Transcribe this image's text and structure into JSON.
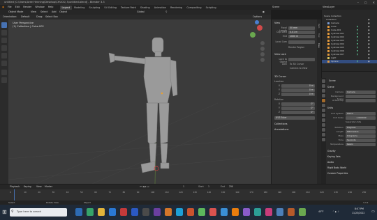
{
  "window": {
    "title": "untitled [C:\\Users\\Aree Henning\\Desktop\\CHUCK\\ 3\\untitled.blend] - Blender 3.3",
    "min": "–",
    "max": "▢",
    "close": "✕"
  },
  "menu": [
    "File",
    "Edit",
    "Render",
    "Window",
    "Help"
  ],
  "workspaces": [
    "Layout",
    "Modeling",
    "Sculpting",
    "UV Editing",
    "Texture Paint",
    "Shading",
    "Animation",
    "Rendering",
    "Compositing",
    "Scripting"
  ],
  "active_workspace": "Layout",
  "scene": "Scene",
  "view_layer": "ViewLayer",
  "viewport_header": {
    "mode": "Object Mode",
    "view": "View",
    "select": "Select",
    "add": "Add",
    "object": "Object",
    "transform": "Global",
    "orientation": "Orientation:",
    "orientation_value": "Default",
    "drag": "Drag:",
    "drag_value": "Select Box",
    "options": "Options"
  },
  "viewport": {
    "line1": "User Perspective",
    "line2": "(1) Collection | Cube.002"
  },
  "npanel": {
    "view_title": "View",
    "focal_label": "Focal Length",
    "focal_value": "50 mm",
    "clip_label": "Clip Start",
    "clip_start": "0.01 m",
    "end_label": "End",
    "clip_end": "1000 m",
    "local_label": "Local Cam",
    "render_region": "Render Region",
    "view_lock": "View Lock",
    "lock_obj_label": "Lock to Object",
    "lock_label": "Lock",
    "lock_3d": "To 3D Cursor",
    "lock_cam": "Camera to View",
    "cursor_title": "3D Cursor",
    "location_label": "Location",
    "x_label": "X",
    "y_label": "Y",
    "z_label": "Z",
    "cx": "0 m",
    "cy": "0 m",
    "cz": "0 m",
    "rotation_label": "Rotation",
    "rx": "0°",
    "ry": "0°",
    "rz": "0°",
    "rot_mode": "XYZ Euler",
    "collections": "Collections",
    "annotations": "Annotations"
  },
  "vtabs": [
    "Item",
    "Tool",
    "View"
  ],
  "outliner": {
    "header": "Scene Collection",
    "collection": "Collection",
    "items": [
      "Camera",
      "Cube",
      "Cube.001",
      "Cylinder.001",
      "Cylinder.002",
      "Cylinder.003",
      "Cylinder.004",
      "Cylinder.005",
      "Cylinder.006",
      "Cylinder.007",
      "Light",
      "Sphere"
    ]
  },
  "properties": {
    "scene_label": "Scene",
    "scene_section": "Scene",
    "camera_label": "Camera",
    "camera_value": "Camera",
    "bg_label": "Background Scene",
    "clip_label": "Active Clip",
    "units_section": "Units",
    "unit_system_label": "Unit System",
    "unit_system": "Metric",
    "unit_scale_label": "Unit Scale",
    "unit_scale": "1.000000",
    "separate": "Separate Units",
    "rotation_label": "Rotation",
    "rotation": "Degrees",
    "length_label": "Length",
    "length": "Millimeters",
    "mass_label": "Mass",
    "mass": "Kilograms",
    "time_label": "Time",
    "time": "Seconds",
    "temp_label": "Temperature",
    "temp": "Kelvin",
    "gravity": "Gravity",
    "keying": "Keying Sets",
    "audio": "Audio",
    "rigid": "Rigid Body World",
    "custom": "Custom Properties",
    "simplify": "Simplify"
  },
  "timeline": {
    "playback": "Playback",
    "keying": "Keying",
    "view": "View",
    "marker": "Marker",
    "frame": "1",
    "start_label": "Start",
    "start": "1",
    "end_label": "End",
    "end": "250",
    "ticks": [
      "0",
      "10",
      "20",
      "30",
      "40",
      "50",
      "60",
      "70",
      "80",
      "90",
      "100",
      "110",
      "120",
      "130",
      "140",
      "150",
      "160",
      "170",
      "180",
      "190",
      "200",
      "210",
      "220",
      "230",
      "240",
      "250"
    ]
  },
  "status": {
    "select": "Select",
    "rotate": "Rotate View",
    "menu": "Object",
    "version": "3.3.1"
  },
  "taskbar": {
    "search": "Type here to search",
    "temp": "45°F",
    "time": "8:07 PM",
    "date": "11/23/2022"
  }
}
